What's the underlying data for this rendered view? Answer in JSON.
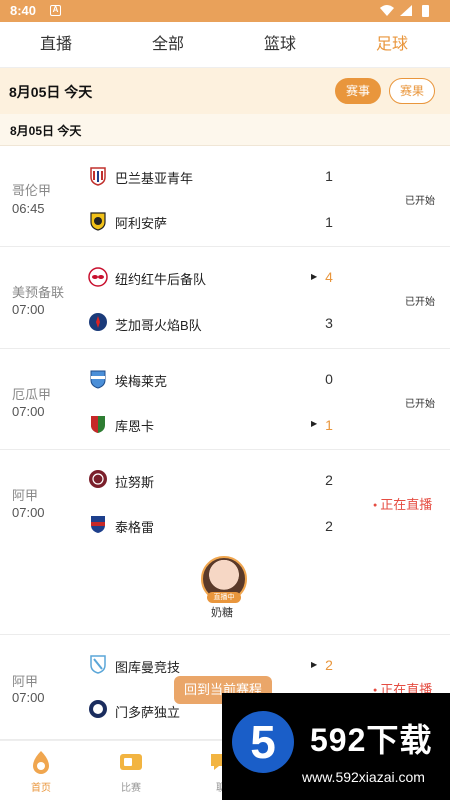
{
  "status_bar": {
    "time": "8:40",
    "notif_glyph": "A"
  },
  "tabs": [
    {
      "label": "直播",
      "active": false
    },
    {
      "label": "全部",
      "active": false
    },
    {
      "label": "篮球",
      "active": false
    },
    {
      "label": "足球",
      "active": true
    }
  ],
  "date_bar": {
    "date": "8月05日  今天",
    "events_label": "赛事",
    "results_label": "赛果"
  },
  "sub_date": "8月05日  今天",
  "matches": [
    {
      "league": "哥伦甲",
      "time": "06:45",
      "home": {
        "name": "巴兰基亚青年",
        "score": "1",
        "icon": "shield-red-white"
      },
      "away": {
        "name": "阿利安萨",
        "score": "1",
        "icon": "lion-yellow"
      },
      "status": "已开始"
    },
    {
      "league": "美预备联",
      "time": "07:00",
      "home": {
        "name": "纽约红牛后备队",
        "score": "4",
        "icon": "redbull-badge"
      },
      "away": {
        "name": "芝加哥火焰B队",
        "score": "3",
        "icon": "fire-blue"
      },
      "status": "已开始"
    },
    {
      "league": "厄瓜甲",
      "time": "07:00",
      "home": {
        "name": "埃梅莱克",
        "score": "0",
        "icon": "shield-blue"
      },
      "away": {
        "name": "库恩卡",
        "score": "1",
        "icon": "shield-green"
      },
      "status": "已开始"
    },
    {
      "league": "阿甲",
      "time": "07:00",
      "home": {
        "name": "拉努斯",
        "score": "2",
        "icon": "badge-maroon"
      },
      "away": {
        "name": "泰格雷",
        "score": "2",
        "icon": "shield-blue-red"
      },
      "status": "正在直播",
      "anchor": {
        "tag": "直播中",
        "name": "奶糖"
      }
    },
    {
      "league": "阿甲",
      "time": "07:00",
      "home": {
        "name": "图库曼竞技",
        "score": "2",
        "icon": "shield-lightblue"
      },
      "away": {
        "name": "门多萨独立",
        "score": "",
        "icon": "badge-navy"
      },
      "status": "正在直播"
    }
  ],
  "back_button": "回到当前赛程",
  "bottom_nav": [
    {
      "label": "首页",
      "icon": "home-icon"
    },
    {
      "label": "比赛",
      "icon": "match-icon"
    },
    {
      "label": "聊",
      "icon": "chat-icon"
    }
  ],
  "watermark": {
    "digit": "5",
    "title": "592下载",
    "url": "www.592xiazai.com"
  },
  "colors": {
    "accent": "#e9963c",
    "live": "#e54d42",
    "statusbar": "#e9a15a",
    "date_bg": "#fdf1de"
  }
}
